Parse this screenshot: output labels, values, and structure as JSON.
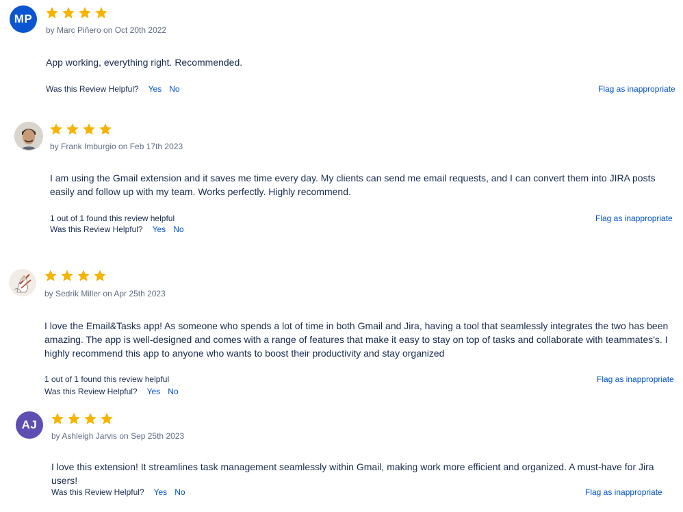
{
  "star_color": "#f5b400",
  "reviews": [
    {
      "initials": "MP",
      "avatar_color": "#0b55d0",
      "rating": 4,
      "byline": "by Marc Piñero on Oct 20th 2022",
      "text": "App working, everything right. Recommended.",
      "found_helpful": "",
      "helpful_question": "Was this Review Helpful?",
      "yes_label": "Yes",
      "no_label": "No",
      "flag_label": "Flag as inappropriate"
    },
    {
      "initials": "",
      "avatar_color": "#c9c4bd",
      "rating": 4,
      "byline": "by Frank Imburgio on Feb 17th 2023",
      "text": "I am using the Gmail extension and it saves me time every day. My clients can send me email requests, and I can convert them into JIRA posts easily and follow up with my team. Works perfectly. Highly recommend.",
      "found_helpful": "1 out of 1 found this review helpful",
      "helpful_question": "Was this Review Helpful?",
      "yes_label": "Yes",
      "no_label": "No",
      "flag_label": "Flag as inappropriate"
    },
    {
      "initials": "",
      "avatar_color": "#efe9e4",
      "rating": 4,
      "byline": "by Sedrik Miller on Apr 25th 2023",
      "text": "I love the Email&Tasks app! As someone who spends a lot of time in both Gmail and Jira, having a tool that seamlessly integrates the two has been amazing. The app is well-designed and comes with a range of features that make it easy to stay on top of tasks and collaborate with teammates's. I highly recommend this app to anyone who wants to boost their productivity and stay organized",
      "found_helpful": "1 out of 1 found this review helpful",
      "helpful_question": "Was this Review Helpful?",
      "yes_label": "Yes",
      "no_label": "No",
      "flag_label": "Flag as inappropriate"
    },
    {
      "initials": "AJ",
      "avatar_color": "#5e4db2",
      "rating": 4,
      "byline": "by Ashleigh Jarvis on Sep 25th 2023",
      "text": "I love this extension! It streamlines task management seamlessly within Gmail, making work more efficient and organized. A must-have for Jira users!",
      "found_helpful": "",
      "helpful_question": "Was this Review Helpful?",
      "yes_label": "Yes",
      "no_label": "No",
      "flag_label": "Flag as inappropriate"
    }
  ]
}
